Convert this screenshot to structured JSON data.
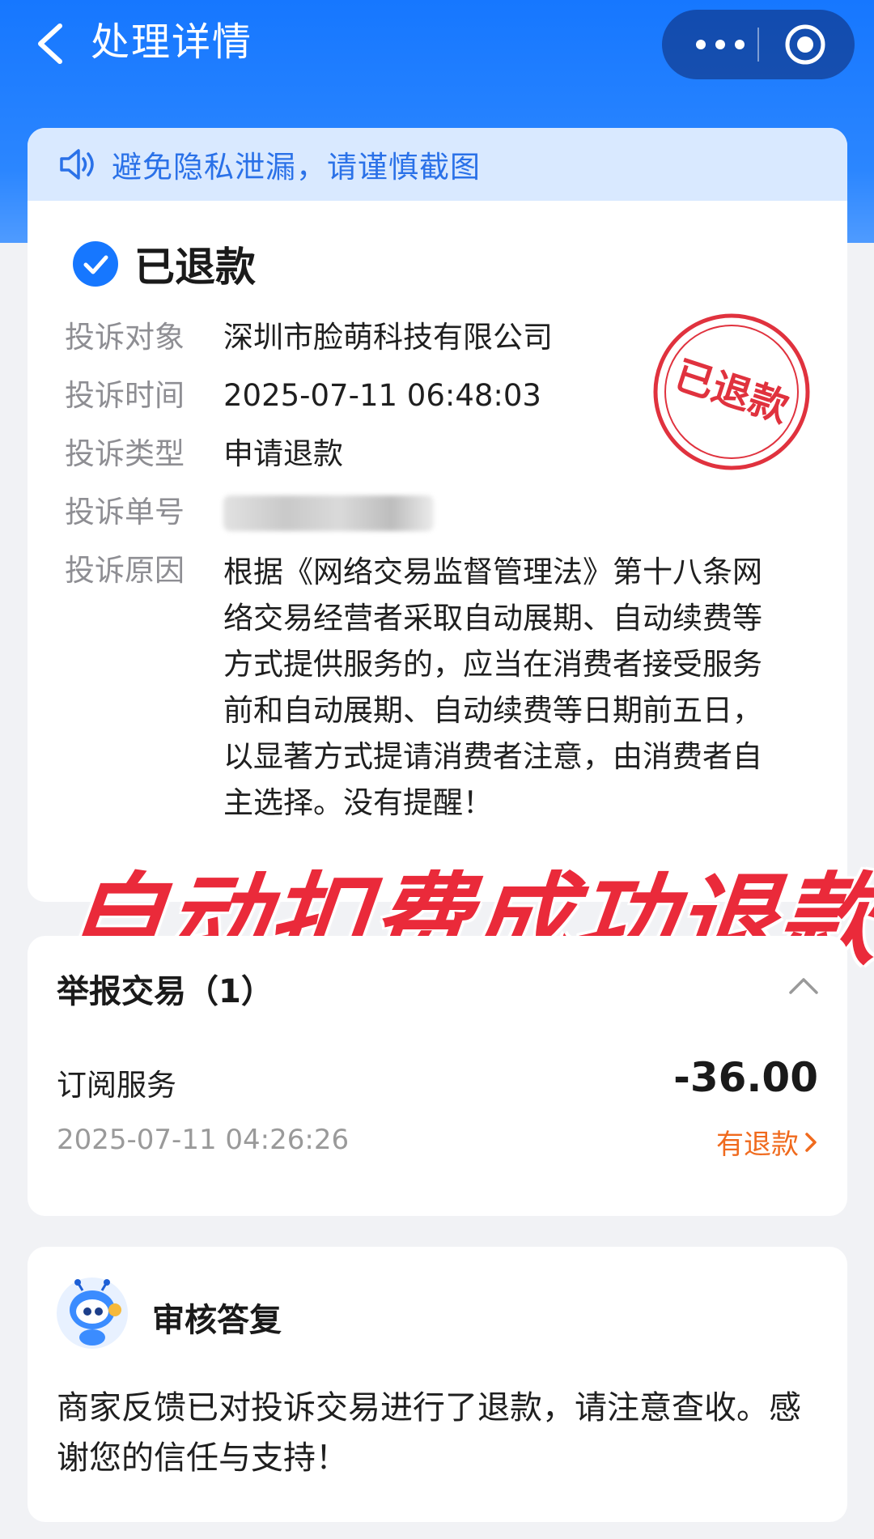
{
  "header": {
    "title": "处理详情",
    "back_icon": "chevron-left-icon",
    "more_icon": "more-dots-icon",
    "close_icon": "target-circle-icon"
  },
  "notice": {
    "text": "避免隐私泄漏，请谨慎截图",
    "icon": "speaker-icon"
  },
  "status": {
    "text": "已退款",
    "icon": "check-circle-icon"
  },
  "details": {
    "target_label": "投诉对象",
    "target_value": "深圳市脸萌科技有限公司",
    "time_label": "投诉时间",
    "time_value": "2025-07-11 06:48:03",
    "type_label": "投诉类型",
    "type_value": "申请退款",
    "number_label": "投诉单号",
    "reason_label": "投诉原因",
    "reason_value": "根据《网络交易监督管理法》第十八条网络交易经营者采取自动展期、自动续费等方式提供服务的，应当在消费者接受服务前和自动展期、自动续费等日期前五日，以显著方式提请消费者注意，由消费者自主选择。没有提醒！"
  },
  "stamp": {
    "text": "已退款",
    "color": "#e0323e"
  },
  "overlay": {
    "text": "自动扣费成功退款",
    "color": "#ea2a3a"
  },
  "trade": {
    "title": "举报交易（1）",
    "item_name": "订阅服务",
    "amount": "-36.00",
    "time": "2025-07-11 04:26:26",
    "refund_link": "有退款"
  },
  "reply": {
    "title": "审核答复",
    "text": "商家反馈已对投诉交易进行了退款，请注意查收。感谢您的信任与支持！"
  },
  "colors": {
    "brand_blue": "#1677ff",
    "notice_bg": "#d9e9ff",
    "refund_orange": "#f06a1d"
  }
}
